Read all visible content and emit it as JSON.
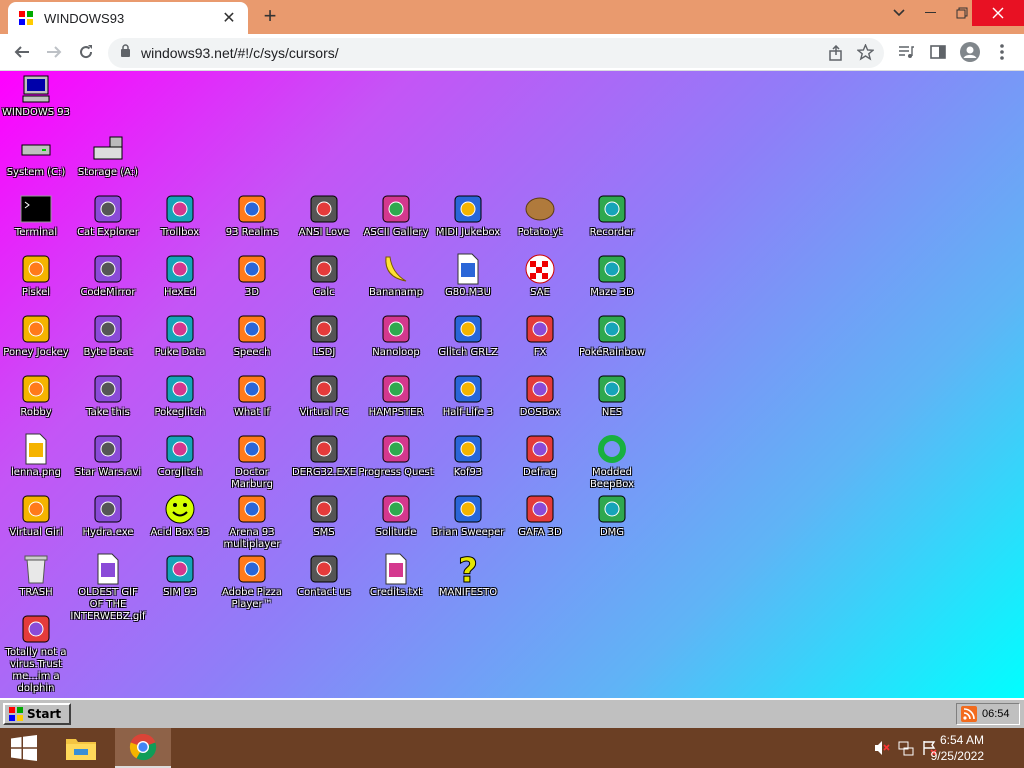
{
  "browser": {
    "tab_title": "WINDOWS93",
    "url": "windows93.net/#!/c/sys/cursors/",
    "new_tab_symbol": "+",
    "close_symbol": "✕"
  },
  "desktop": {
    "icons": [
      {
        "label": "WINDOWS 93",
        "icon": "computer-icon"
      },
      {
        "label": "System (C:)",
        "icon": "drive-icon"
      },
      {
        "label": "Storage (A:)",
        "icon": "floppy-drive-icon"
      },
      {
        "label": "Terminal",
        "icon": "terminal-icon"
      },
      {
        "label": "Cat Explorer",
        "icon": "globe-cat-icon"
      },
      {
        "label": "Trollbox",
        "icon": "chat-bubble-icon"
      },
      {
        "label": "93 Realms",
        "icon": "wizard-icon"
      },
      {
        "label": "ANSI Love",
        "icon": "ansi-icon"
      },
      {
        "label": "ASCII Gallery",
        "icon": "ascii-icon"
      },
      {
        "label": "MIDI Jukebox",
        "icon": "piano-icon"
      },
      {
        "label": "Potato.yt",
        "icon": "potato-icon"
      },
      {
        "label": "Recorder",
        "icon": "microphone-icon"
      },
      {
        "label": "Piskel",
        "icon": "palette-icon"
      },
      {
        "label": "CodeMirror",
        "icon": "codemirror-icon"
      },
      {
        "label": "HexEd",
        "icon": "cube-icon"
      },
      {
        "label": "3D",
        "icon": "teapot-icon"
      },
      {
        "label": "Calc",
        "icon": "calculator-icon"
      },
      {
        "label": "Bananamp",
        "icon": "banana-icon"
      },
      {
        "label": "G80.M3U",
        "icon": "speaker-file-icon"
      },
      {
        "label": "SAE",
        "icon": "ball-icon"
      },
      {
        "label": "Maze 3D",
        "icon": "maze-icon"
      },
      {
        "label": "Poney Jockey",
        "icon": "pony-icon"
      },
      {
        "label": "Byte Beat",
        "icon": "bytebeat-icon"
      },
      {
        "label": "Puke Data",
        "icon": "puredata-icon"
      },
      {
        "label": "Speech",
        "icon": "face-icon"
      },
      {
        "label": "LSDJ",
        "icon": "gameboy-icon"
      },
      {
        "label": "Nanoloop",
        "icon": "wave-icon"
      },
      {
        "label": "Glitch GRLZ",
        "icon": "lips-icon"
      },
      {
        "label": "FX",
        "icon": "atom-icon"
      },
      {
        "label": "PokéRainbow",
        "icon": "pokerainbow-icon"
      },
      {
        "label": "Robby",
        "icon": "stickman-icon"
      },
      {
        "label": "Take this",
        "icon": "old-man-icon"
      },
      {
        "label": "Pokeglitch",
        "icon": "pokeglitch-icon"
      },
      {
        "label": "What If",
        "icon": "matrix-icon"
      },
      {
        "label": "Virtual PC",
        "icon": "window-icon"
      },
      {
        "label": "HAMPSTER",
        "icon": "hamster-icon"
      },
      {
        "label": "Half-Life 3",
        "icon": "lambda-icon"
      },
      {
        "label": "DOSBox",
        "icon": "dosbox-icon"
      },
      {
        "label": "NES",
        "icon": "nes-icon"
      },
      {
        "label": "lenna.png",
        "icon": "image-file-icon"
      },
      {
        "label": "Star Wars.avi",
        "icon": "yoda-icon"
      },
      {
        "label": "Corglitch",
        "icon": "corgi-icon"
      },
      {
        "label": "Doctor Marburg",
        "icon": "doctor-icon"
      },
      {
        "label": "DERG32.EXE",
        "icon": "monitor-face-icon"
      },
      {
        "label": "Progress Quest",
        "icon": "swords-icon"
      },
      {
        "label": "Kof93",
        "icon": "fighter-icon"
      },
      {
        "label": "Defrag",
        "icon": "defrag-icon"
      },
      {
        "label": "Modded BeepBox",
        "icon": "ring-icon"
      },
      {
        "label": "Virtual Girl",
        "icon": "girl-icon"
      },
      {
        "label": "Hydra.exe",
        "icon": "hydra-icon"
      },
      {
        "label": "Acid Box 93",
        "icon": "smiley-icon"
      },
      {
        "label": "Arena 93 multiplayer",
        "icon": "arena-cube-icon"
      },
      {
        "label": "SMS",
        "icon": "sms-icon"
      },
      {
        "label": "Solitude",
        "icon": "bottle-icon"
      },
      {
        "label": "Brian Sweeper",
        "icon": "mine-icon"
      },
      {
        "label": "GAFA 3D",
        "icon": "doomguy-icon"
      },
      {
        "label": "DMG",
        "icon": "dmg-icon"
      },
      {
        "label": "TRASH",
        "icon": "trash-icon"
      },
      {
        "label": "OLDEST GIF OF THE INTERWEBZ.gif",
        "icon": "gif-file-icon"
      },
      {
        "label": "SIM 93",
        "icon": "book-icon"
      },
      {
        "label": "Adobe Pizza Player™",
        "icon": "pizza-icon"
      },
      {
        "label": "Contact us",
        "icon": "contact-icon"
      },
      {
        "label": "Credits.txt",
        "icon": "text-file-icon"
      },
      {
        "label": "MANIFESTO",
        "icon": "question-icon"
      },
      {
        "label": "Totally not a virus.Trust me...im a dolphin",
        "icon": "dolphin-icon"
      }
    ]
  },
  "w93_taskbar": {
    "start_label": "Start",
    "clock": "06:54"
  },
  "windows_taskbar": {
    "time": "6:54 AM",
    "date": "9/25/2022"
  }
}
